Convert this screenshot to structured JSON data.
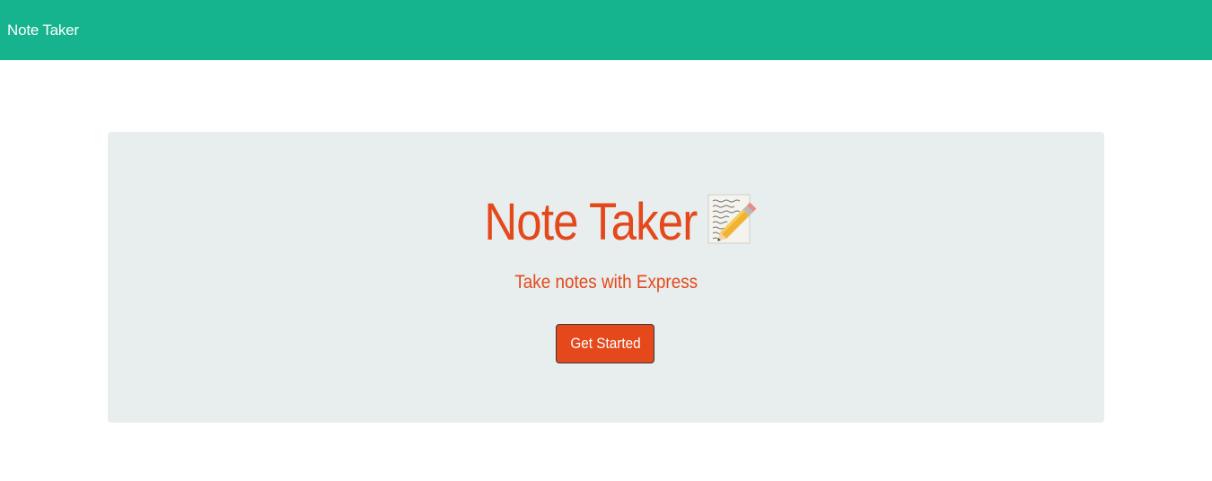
{
  "navbar": {
    "brand": "Note Taker",
    "background_color": "#16b38f"
  },
  "hero": {
    "title": "Note Taker",
    "title_icon": "memo-icon",
    "subtitle": "Take notes with Express",
    "button_label": "Get Started",
    "accent_color": "#e4481b",
    "panel_color": "#e8eeee"
  }
}
